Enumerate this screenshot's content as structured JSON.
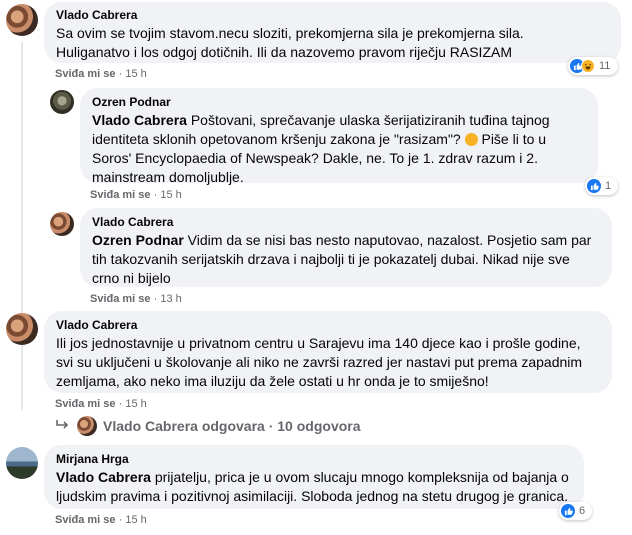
{
  "comments": [
    {
      "author": "Vlado Cabrera",
      "lines": [
        "Sa ovim se tvojim stavom.necu sloziti, prekomjerna sila je prekomjerna sila.",
        "Huliganatvo i los odgoj dotičnih. Ili da nazovemo pravom riječju RASIZAM"
      ],
      "like_label": "Sviđa mi se",
      "time": "15 h",
      "reaction_count": "11"
    },
    {
      "author": "Ozren Podnar",
      "mention": "Vlado Cabrera",
      "lines": [
        " Poštovani, sprečavanje ulaska šerijatiziranih tuđina tajnog",
        "identiteta sklonih opetovanom kršenju zakona je \"rasizam\"?",
        " Piše li to u",
        "Soros' Encyclopaedia of Newspeak? Dakle, ne. To je 1. zdrav razum i 2.",
        "mainstream domoljublje."
      ],
      "like_label": "Sviđa mi se",
      "time": "15 h",
      "reaction_count": "1"
    },
    {
      "author": "Vlado Cabrera",
      "mention": "Ozren Podnar",
      "lines": [
        " Vidim da se nisi bas nesto naputovao, nazalost. Posjetio sam par",
        "tih takozvanih serijatskih drzava i najbolji ti je pokazatelj dubai. Nikad nije sve",
        "crno ni bijelo"
      ],
      "like_label": "Sviđa mi se",
      "time": "13 h"
    },
    {
      "author": "Vlado Cabrera",
      "lines": [
        "Ili jos jednostavnije u privatnom centru u Sarajevu ima 140 djece kao i prošle godine,",
        "svi su uključeni u školovanje ali niko ne završi razred jer nastavi put prema zapadnim",
        "zemljama, ako neko ima iluziju da žele ostati u hr onda je to smiješno!"
      ],
      "like_label": "Sviđa mi se",
      "time": "15 h",
      "replies_label": "Vlado Cabrera odgovara · 10 odgovora"
    },
    {
      "author": "Mirjana Hrga",
      "mention": "Vlado Cabrera",
      "lines": [
        " prijatelju, prica je u ovom slucaju mnogo kompleksnija od bajanja o",
        "ljudskim pravima i pozitivnoj asimilaciji. Sloboda jednog na stetu drugog je granica."
      ],
      "like_label": "Sviđa mi se",
      "time": "15 h",
      "reaction_count": "6"
    }
  ],
  "dot": "·",
  "colors": {
    "bubble": "#f0f2f5",
    "like_blue": "#1877f2",
    "haha_yellow": "#f7b125",
    "meta_gray": "#65676b"
  },
  "icons": [
    "like-reaction-icon",
    "haha-reaction-icon",
    "reply-arrow-icon",
    "laughing-emoji-icon"
  ]
}
